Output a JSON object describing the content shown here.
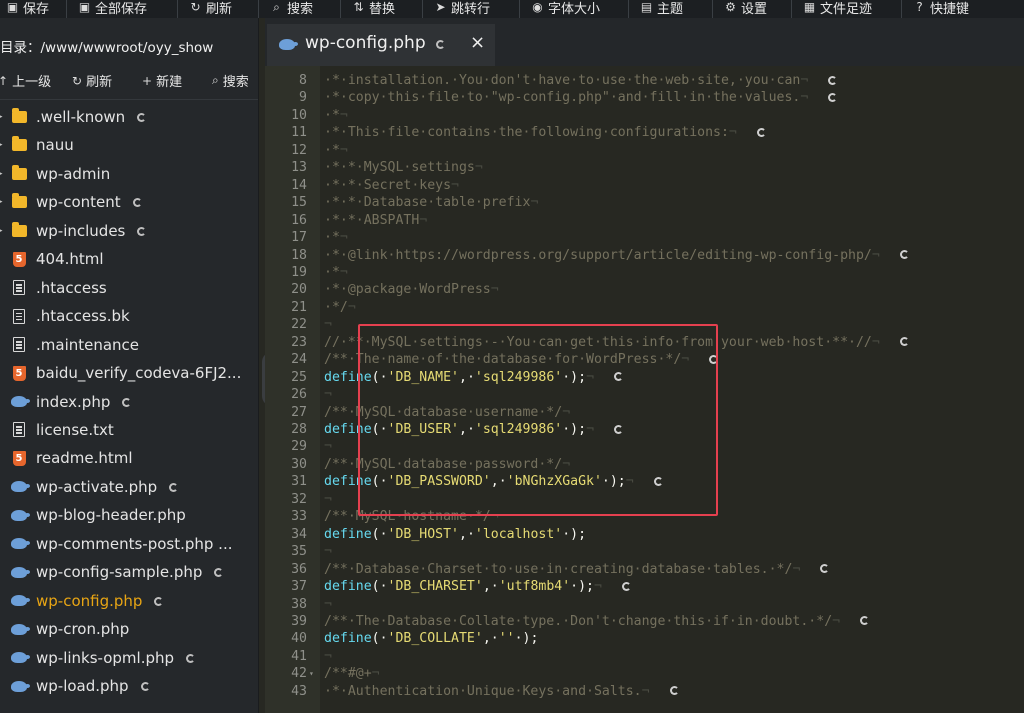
{
  "toolbar": {
    "items": [
      {
        "label": "保存",
        "icon": "save-icon"
      },
      {
        "label": "全部保存",
        "icon": "save-all-icon"
      },
      {
        "label": "刷新",
        "icon": "refresh-icon"
      },
      {
        "label": "搜索",
        "icon": "search-icon"
      },
      {
        "label": "替换",
        "icon": "replace-icon"
      },
      {
        "label": "跳转行",
        "icon": "goto-line-icon"
      },
      {
        "label": "字体大小",
        "icon": "font-size-icon"
      },
      {
        "label": "主题",
        "icon": "theme-icon"
      },
      {
        "label": "设置",
        "icon": "gear-icon"
      },
      {
        "label": "文件足迹",
        "icon": "history-icon"
      },
      {
        "label": "快捷键",
        "icon": "help-icon"
      }
    ]
  },
  "sidebar": {
    "path_label": "目录：/www/wwwroot/oyy_show",
    "actions": [
      {
        "label": "上一级",
        "icon": "up-icon"
      },
      {
        "label": "刷新",
        "icon": "refresh-icon"
      },
      {
        "label": "新建",
        "icon": "plus-icon"
      },
      {
        "label": "搜索",
        "icon": "search-icon"
      }
    ],
    "files": [
      {
        "name": ".well-known",
        "type": "folder",
        "spinner": true
      },
      {
        "name": "nauu",
        "type": "folder",
        "spinner": false
      },
      {
        "name": "wp-admin",
        "type": "folder",
        "spinner": false
      },
      {
        "name": "wp-content",
        "type": "folder",
        "spinner": true
      },
      {
        "name": "wp-includes",
        "type": "folder",
        "spinner": true
      },
      {
        "name": "404.html",
        "type": "html",
        "spinner": false
      },
      {
        "name": ".htaccess",
        "type": "doc",
        "spinner": false
      },
      {
        "name": ".htaccess.bk",
        "type": "doc",
        "spinner": false
      },
      {
        "name": ".maintenance",
        "type": "doc",
        "spinner": false
      },
      {
        "name": "baidu_verify_codeva-6FJ2...",
        "type": "html",
        "spinner": false
      },
      {
        "name": "index.php",
        "type": "php",
        "spinner": true
      },
      {
        "name": "license.txt",
        "type": "doc",
        "spinner": false
      },
      {
        "name": "readme.html",
        "type": "html",
        "spinner": false
      },
      {
        "name": "wp-activate.php",
        "type": "php",
        "spinner": true
      },
      {
        "name": "wp-blog-header.php",
        "type": "php",
        "spinner": false
      },
      {
        "name": "wp-comments-post.php ...",
        "type": "php",
        "spinner": false
      },
      {
        "name": "wp-config-sample.php",
        "type": "php",
        "spinner": true
      },
      {
        "name": "wp-config.php",
        "type": "php",
        "spinner": true,
        "active": true
      },
      {
        "name": "wp-cron.php",
        "type": "php",
        "spinner": false
      },
      {
        "name": "wp-links-opml.php",
        "type": "php",
        "spinner": true
      },
      {
        "name": "wp-load.php",
        "type": "php",
        "spinner": true
      }
    ]
  },
  "tab": {
    "label": "wp-config.php",
    "close": "×"
  },
  "editor": {
    "lines": [
      {
        "n": "8",
        "segs": [
          [
            "c-cmt",
            "·*·installation.·You·don't·have·to·use·the·web·site,·you·can"
          ],
          [
            "c-invis",
            "¬"
          ]
        ],
        "spinner": true
      },
      {
        "n": "9",
        "segs": [
          [
            "c-cmt",
            "·*·copy·this·file·to·\"wp-config.php\"·and·fill·in·the·values."
          ],
          [
            "c-invis",
            "¬"
          ]
        ],
        "spinner": true
      },
      {
        "n": "10",
        "segs": [
          [
            "c-cmt",
            "·*"
          ],
          [
            "c-invis",
            "¬"
          ]
        ],
        "spinner": false
      },
      {
        "n": "11",
        "segs": [
          [
            "c-cmt",
            "·*·This·file·contains·the·following·configurations:"
          ],
          [
            "c-invis",
            "¬"
          ]
        ],
        "spinner": true
      },
      {
        "n": "12",
        "segs": [
          [
            "c-cmt",
            "·*"
          ],
          [
            "c-invis",
            "¬"
          ]
        ],
        "spinner": false
      },
      {
        "n": "13",
        "segs": [
          [
            "c-cmt",
            "·*·*·MySQL·settings"
          ],
          [
            "c-invis",
            "¬"
          ]
        ],
        "spinner": false
      },
      {
        "n": "14",
        "segs": [
          [
            "c-cmt",
            "·*·*·Secret·keys"
          ],
          [
            "c-invis",
            "¬"
          ]
        ],
        "spinner": false
      },
      {
        "n": "15",
        "segs": [
          [
            "c-cmt",
            "·*·*·Database·table·prefix"
          ],
          [
            "c-invis",
            "¬"
          ]
        ],
        "spinner": false
      },
      {
        "n": "16",
        "segs": [
          [
            "c-cmt",
            "·*·*·ABSPATH"
          ],
          [
            "c-invis",
            "¬"
          ]
        ],
        "spinner": false
      },
      {
        "n": "17",
        "segs": [
          [
            "c-cmt",
            "·*"
          ],
          [
            "c-invis",
            "¬"
          ]
        ],
        "spinner": false
      },
      {
        "n": "18",
        "segs": [
          [
            "c-cmt",
            "·*·@link·https://wordpress.org/support/article/editing-wp-config-php/"
          ],
          [
            "c-invis",
            "¬"
          ]
        ],
        "spinner": true
      },
      {
        "n": "19",
        "segs": [
          [
            "c-cmt",
            "·*"
          ],
          [
            "c-invis",
            "¬"
          ]
        ],
        "spinner": false
      },
      {
        "n": "20",
        "segs": [
          [
            "c-cmt",
            "·*·@package·WordPress"
          ],
          [
            "c-invis",
            "¬"
          ]
        ],
        "spinner": false
      },
      {
        "n": "21",
        "segs": [
          [
            "c-cmt",
            "·*/"
          ],
          [
            "c-invis",
            "¬"
          ]
        ],
        "spinner": false
      },
      {
        "n": "22",
        "segs": [
          [
            "c-invis",
            "¬"
          ]
        ],
        "spinner": false
      },
      {
        "n": "23",
        "segs": [
          [
            "c-cmt",
            "//·**·MySQL·settings·-·You·can·get·this·info·from·your·web·host·**·//"
          ],
          [
            "c-invis",
            "¬"
          ]
        ],
        "spinner": true
      },
      {
        "n": "24",
        "segs": [
          [
            "c-cmt",
            "/**·The·name·of·the·database·for·WordPress·*/"
          ],
          [
            "c-invis",
            "¬"
          ]
        ],
        "spinner": true
      },
      {
        "n": "25",
        "segs": [
          [
            "c-fn",
            "define"
          ],
          [
            "c-p",
            "(·"
          ],
          [
            "c-str",
            "'DB_NAME'"
          ],
          [
            "c-p",
            ",·"
          ],
          [
            "c-str",
            "'sql249986'"
          ],
          [
            "c-p",
            "·);"
          ],
          [
            "c-invis",
            "¬"
          ]
        ],
        "spinner": true
      },
      {
        "n": "26",
        "segs": [
          [
            "c-invis",
            "¬"
          ]
        ],
        "spinner": false
      },
      {
        "n": "27",
        "segs": [
          [
            "c-cmt",
            "/**·MySQL·database·username·*/"
          ],
          [
            "c-invis",
            "¬"
          ]
        ],
        "spinner": false
      },
      {
        "n": "28",
        "segs": [
          [
            "c-fn",
            "define"
          ],
          [
            "c-p",
            "(·"
          ],
          [
            "c-str",
            "'DB_USER'"
          ],
          [
            "c-p",
            ",·"
          ],
          [
            "c-str",
            "'sql249986'"
          ],
          [
            "c-p",
            "·);"
          ],
          [
            "c-invis",
            "¬"
          ]
        ],
        "spinner": true
      },
      {
        "n": "29",
        "segs": [
          [
            "c-invis",
            "¬"
          ]
        ],
        "spinner": false
      },
      {
        "n": "30",
        "segs": [
          [
            "c-cmt",
            "/**·MySQL·database·password·*/"
          ],
          [
            "c-invis",
            "¬"
          ]
        ],
        "spinner": false
      },
      {
        "n": "31",
        "segs": [
          [
            "c-fn",
            "define"
          ],
          [
            "c-p",
            "(·"
          ],
          [
            "c-str",
            "'DB_PASSWORD'"
          ],
          [
            "c-p",
            ",·"
          ],
          [
            "c-str",
            "'bNGhzXGaGk'"
          ],
          [
            "c-p",
            "·);"
          ],
          [
            "c-invis",
            "¬"
          ]
        ],
        "spinner": true
      },
      {
        "n": "32",
        "segs": [
          [
            "c-invis",
            "¬"
          ]
        ],
        "spinner": false
      },
      {
        "n": "33",
        "segs": [
          [
            "c-cmt",
            "/**·MySQL·hostname·*/"
          ],
          [
            "c-invis",
            "¬"
          ]
        ],
        "spinner": false
      },
      {
        "n": "34",
        "segs": [
          [
            "c-fn",
            "define"
          ],
          [
            "c-p",
            "(·"
          ],
          [
            "c-str",
            "'DB_HOST'"
          ],
          [
            "c-p",
            ",·"
          ],
          [
            "c-str",
            "'localhost'"
          ],
          [
            "c-p",
            "·);"
          ]
        ],
        "spinner": false
      },
      {
        "n": "35",
        "segs": [
          [
            "c-invis",
            "¬"
          ]
        ],
        "spinner": false
      },
      {
        "n": "36",
        "segs": [
          [
            "c-cmt",
            "/**·Database·Charset·to·use·in·creating·database·tables.·*/"
          ],
          [
            "c-invis",
            "¬"
          ]
        ],
        "spinner": true
      },
      {
        "n": "37",
        "segs": [
          [
            "c-fn",
            "define"
          ],
          [
            "c-p",
            "(·"
          ],
          [
            "c-str",
            "'DB_CHARSET'"
          ],
          [
            "c-p",
            ",·"
          ],
          [
            "c-str",
            "'utf8mb4'"
          ],
          [
            "c-p",
            "·);"
          ],
          [
            "c-invis",
            "¬"
          ]
        ],
        "spinner": true
      },
      {
        "n": "38",
        "segs": [
          [
            "c-invis",
            "¬"
          ]
        ],
        "spinner": false
      },
      {
        "n": "39",
        "segs": [
          [
            "c-cmt",
            "/**·The·Database·Collate·type.·Don't·change·this·if·in·doubt.·*/"
          ],
          [
            "c-invis",
            "¬"
          ]
        ],
        "spinner": true
      },
      {
        "n": "40",
        "segs": [
          [
            "c-fn",
            "define"
          ],
          [
            "c-p",
            "(·"
          ],
          [
            "c-str",
            "'DB_COLLATE'"
          ],
          [
            "c-p",
            ",·"
          ],
          [
            "c-str",
            "''"
          ],
          [
            "c-p",
            "·);"
          ]
        ],
        "spinner": false
      },
      {
        "n": "41",
        "segs": [
          [
            "c-invis",
            "¬"
          ]
        ],
        "spinner": false
      },
      {
        "n": "42",
        "segs": [
          [
            "c-cmt",
            "/**#@+"
          ],
          [
            "c-invis",
            "¬"
          ]
        ],
        "spinner": false,
        "fold": "▾"
      },
      {
        "n": "43",
        "segs": [
          [
            "c-cmt",
            "·*·Authentication·Unique·Keys·and·Salts."
          ],
          [
            "c-invis",
            "¬"
          ]
        ],
        "spinner": true
      }
    ]
  },
  "colors": {
    "active_file": "#e8a514",
    "highlight_box": "#e5404f",
    "string": "#e6db74",
    "function": "#66d9ef",
    "comment": "#75715e"
  }
}
